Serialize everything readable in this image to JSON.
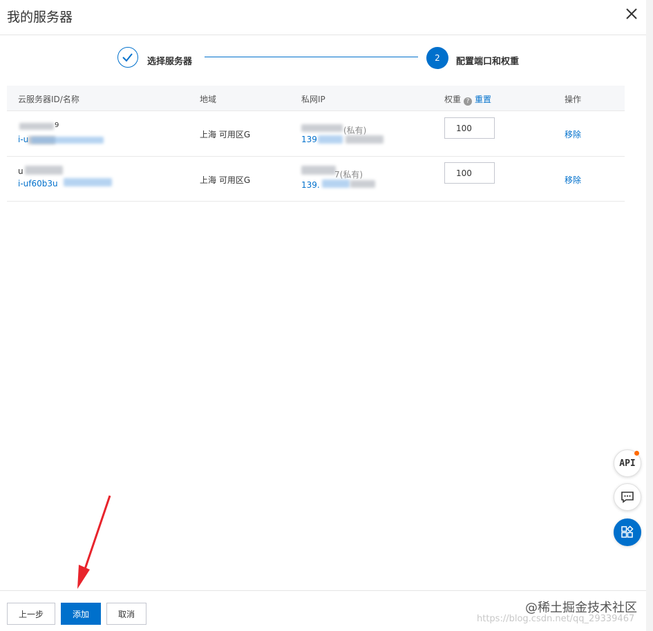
{
  "dialog": {
    "title": "我的服务器"
  },
  "steps": [
    {
      "label": "选择服务器",
      "state": "done"
    },
    {
      "label": "配置端口和权重",
      "state": "active",
      "number": "2"
    }
  ],
  "table": {
    "columns": {
      "id_name": "云服务器ID/名称",
      "region": "地域",
      "private_ip": "私网IP",
      "weight": "权重",
      "weight_help": "?",
      "weight_reset": "重置",
      "actions": "操作"
    },
    "rows": [
      {
        "name_partial": "9",
        "id_partial": "i-u",
        "region": "上海 可用区G",
        "ip_suffix": "(私有)",
        "ip_prefix": "139",
        "weight": "100",
        "action": "移除"
      },
      {
        "name_partial": "u",
        "id_partial": "i-uf60b3u",
        "region": "上海 可用区G",
        "ip_suffix": "7(私有)",
        "ip_prefix": "139.",
        "weight": "100",
        "action": "移除"
      }
    ]
  },
  "footer": {
    "prev_label": "上一步",
    "add_label": "添加",
    "cancel_label": "取消"
  },
  "floating": {
    "api_label": "API"
  },
  "watermark": {
    "brand": "@稀土掘金技术社区",
    "url": "https://blog.csdn.net/qq_29339467"
  },
  "colors": {
    "primary": "#0070cc",
    "annotation_arrow": "#e8242c",
    "notification_dot": "#ff6a00"
  },
  "icons": [
    "close-icon",
    "check-icon",
    "help-icon",
    "api-icon",
    "chat-icon",
    "apps-icon",
    "arrow-annotation"
  ]
}
